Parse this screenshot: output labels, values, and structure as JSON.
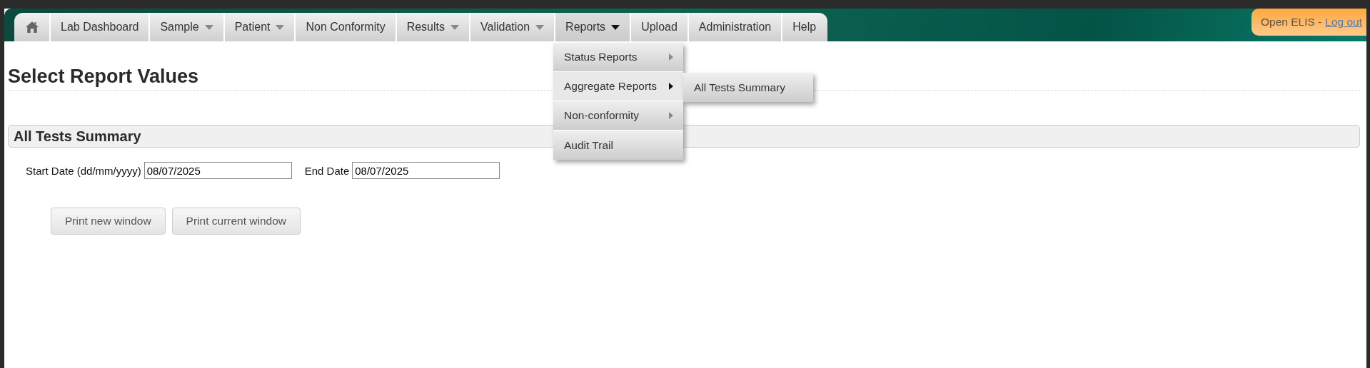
{
  "nav": {
    "tabs": [
      {
        "kind": "home",
        "selected": false
      },
      {
        "kind": "link",
        "label": "Lab Dashboard",
        "has_menu": false,
        "selected": false
      },
      {
        "kind": "link",
        "label": "Sample",
        "has_menu": true,
        "selected": false
      },
      {
        "kind": "link",
        "label": "Patient",
        "has_menu": true,
        "selected": false
      },
      {
        "kind": "link",
        "label": "Non Conformity",
        "has_menu": false,
        "selected": false
      },
      {
        "kind": "link",
        "label": "Results",
        "has_menu": true,
        "selected": false
      },
      {
        "kind": "link",
        "label": "Validation",
        "has_menu": true,
        "selected": false
      },
      {
        "kind": "link",
        "label": "Reports",
        "has_menu": true,
        "selected": true
      },
      {
        "kind": "link",
        "label": "Upload",
        "has_menu": false,
        "selected": false
      },
      {
        "kind": "link",
        "label": "Administration",
        "has_menu": false,
        "selected": false
      },
      {
        "kind": "link",
        "label": "Help",
        "has_menu": false,
        "selected": false
      }
    ],
    "user_box": {
      "app_name": "Open ELIS -",
      "logout": "Log out"
    }
  },
  "reports_menu": {
    "items": [
      {
        "label": "Status Reports",
        "has_submenu": true,
        "selected": false
      },
      {
        "label": "Aggregate Reports",
        "has_submenu": true,
        "selected": true
      },
      {
        "label": "Non-conformity",
        "has_submenu": true,
        "selected": false
      },
      {
        "label": "Audit Trail",
        "has_submenu": false,
        "selected": false
      }
    ],
    "submenu": {
      "items": [
        {
          "label": "All Tests Summary",
          "selected": false
        }
      ]
    }
  },
  "page": {
    "title": "Select Report Values",
    "section_title": "All Tests Summary",
    "fields": [
      {
        "label": "Start Date (dd/mm/yyyy)",
        "value": "08/07/2025"
      },
      {
        "label": "End Date",
        "value": "08/07/2025"
      }
    ],
    "buttons": [
      "Print new window",
      "Print current window"
    ]
  }
}
